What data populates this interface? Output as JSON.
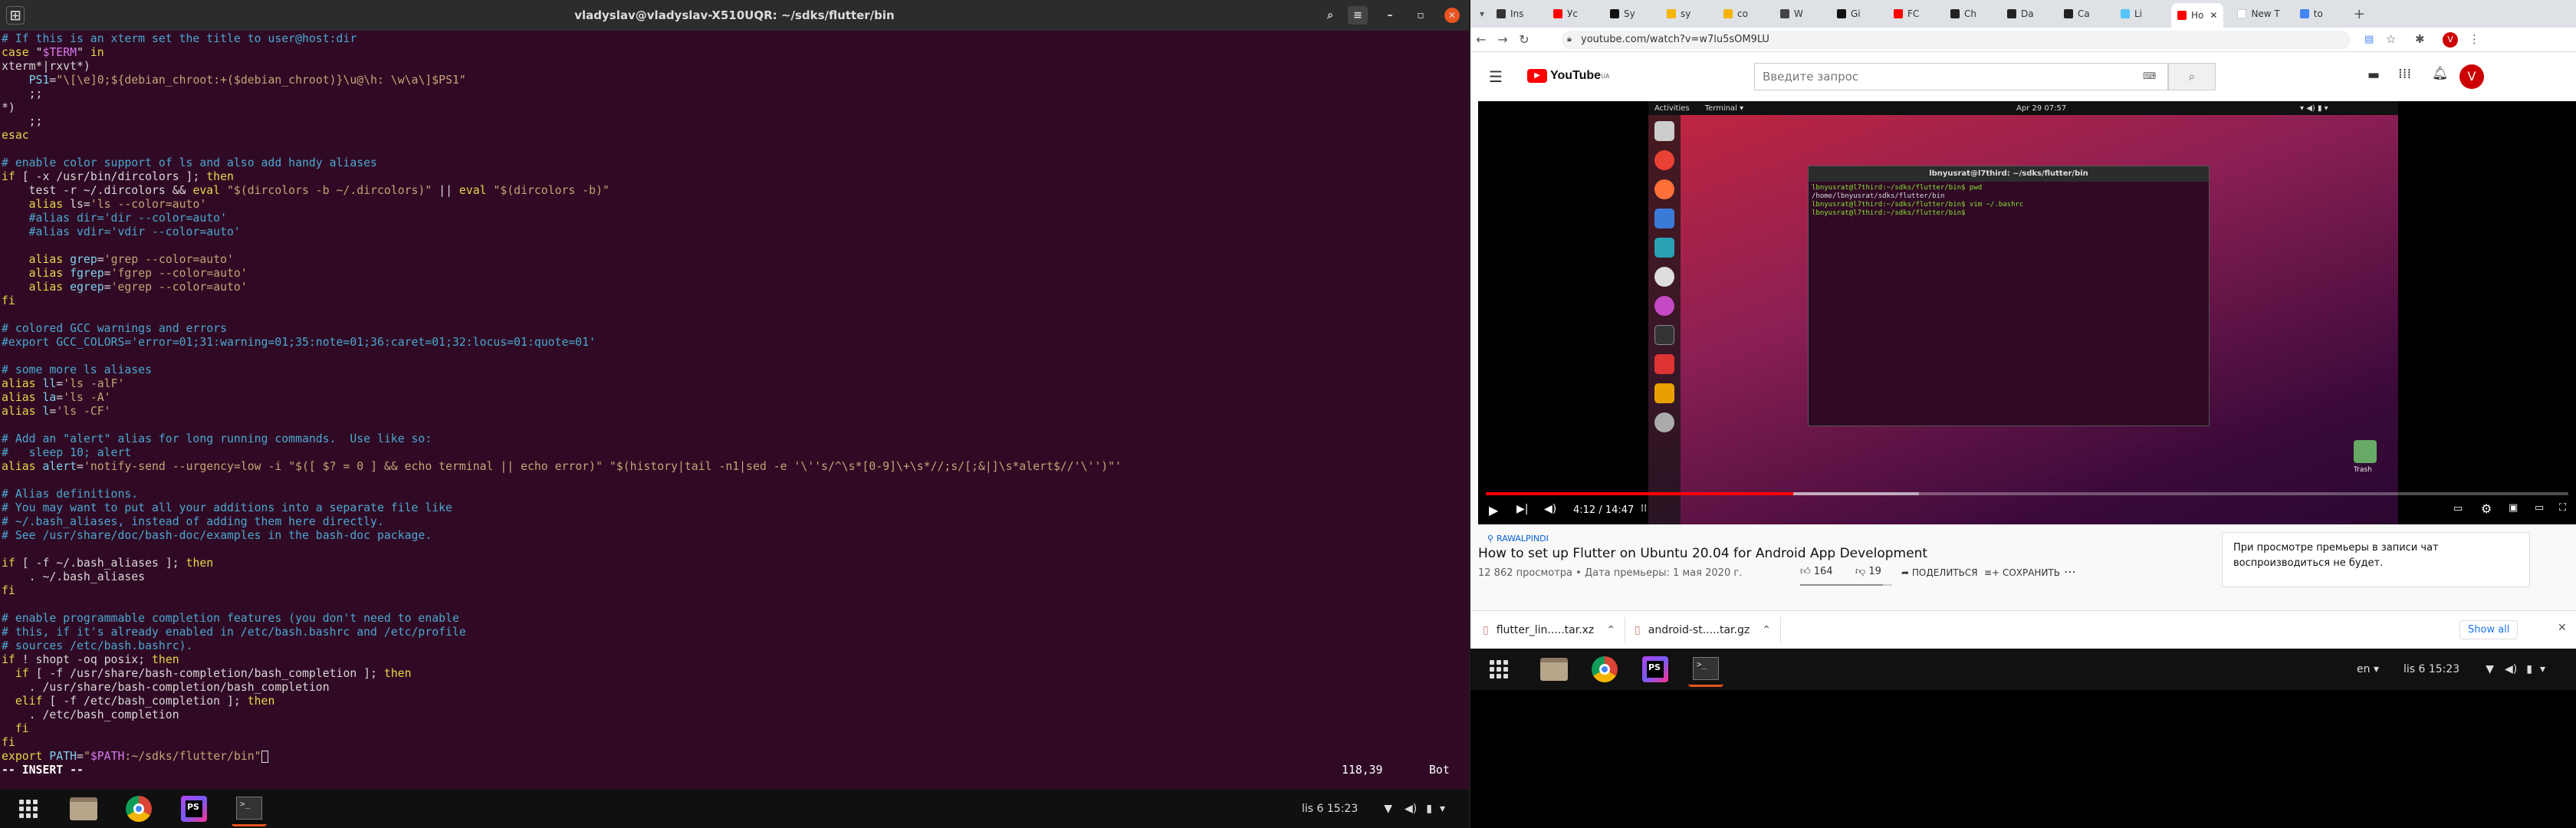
{
  "terminal": {
    "title": "vladyslav@vladyslav-X510UQR: ~/sdks/flutter/bin",
    "lines": [
      [
        [
          "cm",
          "# If this is an xterm set the title to user@host:dir"
        ]
      ],
      [
        [
          "kw",
          "case"
        ],
        [
          "tx",
          " \""
        ],
        [
          "vr",
          "$TERM"
        ],
        [
          "tx",
          "\" "
        ],
        [
          "kw",
          "in"
        ]
      ],
      [
        [
          "tx",
          "xterm*|rxvt*)"
        ]
      ],
      [
        [
          "tx",
          "    "
        ],
        [
          "fn",
          "PS1"
        ],
        [
          "tx",
          "="
        ],
        [
          "st",
          "\"\\[\\e]0;${debian_chroot:+($debian_chroot)}\\u@\\h: \\w\\a\\]$PS1\""
        ]
      ],
      [
        [
          "tx",
          "    ;;"
        ]
      ],
      [
        [
          "tx",
          "*)"
        ]
      ],
      [
        [
          "tx",
          "    ;;"
        ]
      ],
      [
        [
          "kw",
          "esac"
        ]
      ],
      [
        [
          "tx",
          ""
        ]
      ],
      [
        [
          "cm",
          "# enable color support of ls and also add handy aliases"
        ]
      ],
      [
        [
          "kw",
          "if"
        ],
        [
          "tx",
          " [ -x /usr/bin/dircolors ]; "
        ],
        [
          "kw",
          "then"
        ]
      ],
      [
        [
          "tx",
          "    test -r ~/.dircolors && "
        ],
        [
          "kw",
          "eval"
        ],
        [
          "st",
          " \"$(dircolors -b ~/.dircolors)\""
        ],
        [
          "tx",
          " || "
        ],
        [
          "kw",
          "eval"
        ],
        [
          "st",
          " \"$(dircolors -b)\""
        ]
      ],
      [
        [
          "tx",
          "    "
        ],
        [
          "kw",
          "alias"
        ],
        [
          "tx",
          " ls="
        ],
        [
          "st",
          "'ls --color=auto'"
        ]
      ],
      [
        [
          "cm",
          "    #alias dir='dir --color=auto'"
        ]
      ],
      [
        [
          "cm",
          "    #alias vdir='vdir --color=auto'"
        ]
      ],
      [
        [
          "tx",
          ""
        ]
      ],
      [
        [
          "tx",
          "    "
        ],
        [
          "kw",
          "alias"
        ],
        [
          "tx",
          " "
        ],
        [
          "fn",
          "grep"
        ],
        [
          "tx",
          "="
        ],
        [
          "st",
          "'grep --color=auto'"
        ]
      ],
      [
        [
          "tx",
          "    "
        ],
        [
          "kw",
          "alias"
        ],
        [
          "tx",
          " "
        ],
        [
          "fn",
          "fgrep"
        ],
        [
          "tx",
          "="
        ],
        [
          "st",
          "'fgrep --color=auto'"
        ]
      ],
      [
        [
          "tx",
          "    "
        ],
        [
          "kw",
          "alias"
        ],
        [
          "tx",
          " "
        ],
        [
          "fn",
          "egrep"
        ],
        [
          "tx",
          "="
        ],
        [
          "st",
          "'egrep --color=auto'"
        ]
      ],
      [
        [
          "kw",
          "fi"
        ]
      ],
      [
        [
          "tx",
          ""
        ]
      ],
      [
        [
          "cm",
          "# colored GCC warnings and errors"
        ]
      ],
      [
        [
          "cm",
          "#export GCC_COLORS='error=01;31:warning=01;35:note=01;36:caret=01;32:locus=01:quote=01'"
        ]
      ],
      [
        [
          "tx",
          ""
        ]
      ],
      [
        [
          "cm",
          "# some more ls aliases"
        ]
      ],
      [
        [
          "kw",
          "alias"
        ],
        [
          "tx",
          " "
        ],
        [
          "fn",
          "ll"
        ],
        [
          "tx",
          "="
        ],
        [
          "st",
          "'ls -alF'"
        ]
      ],
      [
        [
          "kw",
          "alias"
        ],
        [
          "tx",
          " "
        ],
        [
          "fn",
          "la"
        ],
        [
          "tx",
          "="
        ],
        [
          "st",
          "'ls -A'"
        ]
      ],
      [
        [
          "kw",
          "alias"
        ],
        [
          "tx",
          " "
        ],
        [
          "fn",
          "l"
        ],
        [
          "tx",
          "="
        ],
        [
          "st",
          "'ls -CF'"
        ]
      ],
      [
        [
          "tx",
          ""
        ]
      ],
      [
        [
          "cm",
          "# Add an \"alert\" alias for long running commands.  Use like so:"
        ]
      ],
      [
        [
          "cm",
          "#   sleep 10; alert"
        ]
      ],
      [
        [
          "kw",
          "alias"
        ],
        [
          "tx",
          " "
        ],
        [
          "fn",
          "alert"
        ],
        [
          "tx",
          "="
        ],
        [
          "st",
          "'notify-send --urgency=low -i \"$([ $? = 0 ] && echo terminal || echo error)\" \"$(history|tail -n1|sed -e '\\''s/^\\s*[0-9]\\+\\s*//;s/[;&|]\\s*alert$//'\\'')\"'"
        ]
      ],
      [
        [
          "tx",
          ""
        ]
      ],
      [
        [
          "cm",
          "# Alias definitions."
        ]
      ],
      [
        [
          "cm",
          "# You may want to put all your additions into a separate file like"
        ]
      ],
      [
        [
          "cm",
          "# ~/.bash_aliases, instead of adding them here directly."
        ]
      ],
      [
        [
          "cm",
          "# See /usr/share/doc/bash-doc/examples in the bash-doc package."
        ]
      ],
      [
        [
          "tx",
          ""
        ]
      ],
      [
        [
          "kw",
          "if"
        ],
        [
          "tx",
          " [ -f ~/.bash_aliases ]; "
        ],
        [
          "kw",
          "then"
        ]
      ],
      [
        [
          "tx",
          "    . ~/.bash_aliases"
        ]
      ],
      [
        [
          "kw",
          "fi"
        ]
      ],
      [
        [
          "tx",
          ""
        ]
      ],
      [
        [
          "cm",
          "# enable programmable completion features (you don't need to enable"
        ]
      ],
      [
        [
          "cm",
          "# this, if it's already enabled in /etc/bash.bashrc and /etc/profile"
        ]
      ],
      [
        [
          "cm",
          "# sources /etc/bash.bashrc)."
        ]
      ],
      [
        [
          "kw",
          "if"
        ],
        [
          "tx",
          " ! shopt -oq posix; "
        ],
        [
          "kw",
          "then"
        ]
      ],
      [
        [
          "tx",
          "  "
        ],
        [
          "kw",
          "if"
        ],
        [
          "tx",
          " [ -f /usr/share/bash-completion/bash_completion ]; "
        ],
        [
          "kw",
          "then"
        ]
      ],
      [
        [
          "tx",
          "    . /usr/share/bash-completion/bash_completion"
        ]
      ],
      [
        [
          "tx",
          "  "
        ],
        [
          "kw",
          "elif"
        ],
        [
          "tx",
          " [ -f /etc/bash_completion ]; "
        ],
        [
          "kw",
          "then"
        ]
      ],
      [
        [
          "tx",
          "    . /etc/bash_completion"
        ]
      ],
      [
        [
          "tx",
          "  "
        ],
        [
          "kw",
          "fi"
        ]
      ],
      [
        [
          "kw",
          "fi"
        ]
      ],
      [
        [
          "kw",
          "export"
        ],
        [
          "tx",
          " "
        ],
        [
          "fn",
          "PATH"
        ],
        [
          "tx",
          "="
        ],
        [
          "st",
          "\""
        ],
        [
          "vr",
          "$PATH"
        ],
        [
          "st",
          ":~/sdks/flutter/bin\""
        ]
      ]
    ],
    "mode": "-- INSERT --",
    "position": "118,39",
    "scroll": "Bot"
  },
  "left_dock": {
    "date_time": "lis 6  15:23"
  },
  "browser": {
    "tabs": [
      {
        "label": "Ins",
        "color": "#333"
      },
      {
        "label": "Ус",
        "color": "#f00"
      },
      {
        "label": "Sy",
        "color": "#111"
      },
      {
        "label": "sy",
        "color": "#f4b400"
      },
      {
        "label": "co",
        "color": "#f4b400"
      },
      {
        "label": "W",
        "color": "#444"
      },
      {
        "label": "Gi",
        "color": "#111"
      },
      {
        "label": "FC",
        "color": "#f00"
      },
      {
        "label": "Ch",
        "color": "#222"
      },
      {
        "label": "Da",
        "color": "#222"
      },
      {
        "label": "Ca",
        "color": "#222"
      },
      {
        "label": "Li",
        "color": "#54c5f8"
      },
      {
        "label": "Ho",
        "color": "#f00"
      },
      {
        "label": "New T",
        "color": "#fff"
      },
      {
        "label": "to",
        "color": "#4285f4"
      }
    ],
    "url": "youtube.com/watch?v=w7lu5sOM9LU",
    "downloads": [
      "flutter_lin.....tar.xz",
      "android-st.....tar.gz"
    ],
    "show_all": "Show all"
  },
  "youtube": {
    "logo": "YouTube",
    "logo_region": "UA",
    "search_placeholder": "Введите запрос",
    "location_tag": "RAWALPINDI",
    "video_title": "How to set up Flutter on Ubuntu 20.04 for Android App Development",
    "views": "12 862 просмотра • Дата премьеры: 1 мая 2020 г.",
    "likes": "164",
    "dislikes": "19",
    "share": "ПОДЕЛИТЬСЯ",
    "save": "СОХРАНИТЬ",
    "premiere_notice": "При просмотре премьеры в записи чат воспроизводиться не будет.",
    "time": "4:12 / 14:47",
    "progress_fraction": 0.284,
    "buffered_fraction": 0.4,
    "user_initial": "V"
  },
  "video_desktop": {
    "activities": "Activities",
    "terminal_menu": "Terminal ▾",
    "date": "Apr 29  07:57",
    "trash": "Trash",
    "inner_title": "lbnyusrat@l7third: ~/sdks/flutter/bin",
    "inner_lines": [
      "lbnyusrat@l7third:~/sdks/flutter/bin$ pwd",
      "/home/lbnyusrat/sdks/flutter/bin",
      "lbnyusrat@l7third:~/sdks/flutter/bin$ vim ~/.bashrc",
      "lbnyusrat@l7third:~/sdks/flutter/bin$"
    ]
  },
  "right_dock": {
    "lang": "en",
    "date_time": "lis 6  15:23"
  }
}
